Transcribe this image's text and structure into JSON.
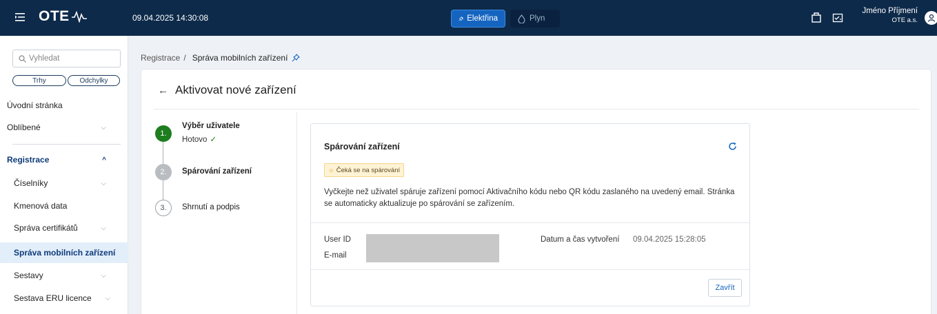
{
  "header": {
    "logo_text": "OTE",
    "datetime": "09.04.2025 14:30:08",
    "segments": [
      {
        "label": "Elektřina",
        "active": true
      },
      {
        "label": "Plyn",
        "active": false
      }
    ],
    "user_name": "Jméno Příjmení",
    "company": "OTE a.s.",
    "icons": [
      "menu-icon",
      "inbox-icon",
      "task-icon",
      "user-icon"
    ]
  },
  "sidebar": {
    "search_placeholder": "Vyhledat",
    "pills": [
      "Trhy",
      "Odchylky"
    ],
    "items": [
      {
        "label": "Úvodní stránka"
      },
      {
        "label": "Oblíbené",
        "chevron": "⌵"
      },
      {
        "label": "Registrace",
        "chevron": "^"
      },
      {
        "label": "Číselníky",
        "chevron": "⌵"
      },
      {
        "label": "Kmenová data"
      },
      {
        "label": "Správa certifikátů",
        "chevron": "⌵"
      },
      {
        "label": "Správa mobilních zařízení"
      },
      {
        "label": "Sestavy",
        "chevron": "⌵"
      },
      {
        "label": "Sestava ERU licence",
        "chevron": "⌵"
      }
    ]
  },
  "breadcrumb": {
    "parent": "Registrace",
    "separator": "/",
    "current": "Správa mobilních zařízení"
  },
  "page": {
    "back_arrow": "←",
    "title": "Aktivovat nové zařízení"
  },
  "steps": [
    {
      "number": "1.",
      "label": "Výběr uživatele",
      "status": "Hotovo",
      "status_icon": "✓"
    },
    {
      "number": "2.",
      "label": "Spárování zařízení"
    },
    {
      "number": "3.",
      "label": "Shrnutí a podpis"
    }
  ],
  "pairing": {
    "title": "Spárování zařízení",
    "badge": "Čeká se na spárování",
    "badge_icon": "☼",
    "description": "Vyčkejte než uživatel spáruje zařízení pomocí Aktivačního kódu nebo QR kódu zaslaného na uvedený email. Stránka se automaticky aktualizuje po spárování se zařízením.",
    "user_id_label": "User ID",
    "email_label": "E-mail",
    "created_label": "Datum a čas vytvoření",
    "created_value": "09.04.2025 15:28:05",
    "close_label": "Zavřít"
  },
  "colors": {
    "header_bg": "#0d2a4a",
    "accent": "#1565c0",
    "step_done": "#1e7d1f",
    "selected_bg": "#e3eefb"
  }
}
